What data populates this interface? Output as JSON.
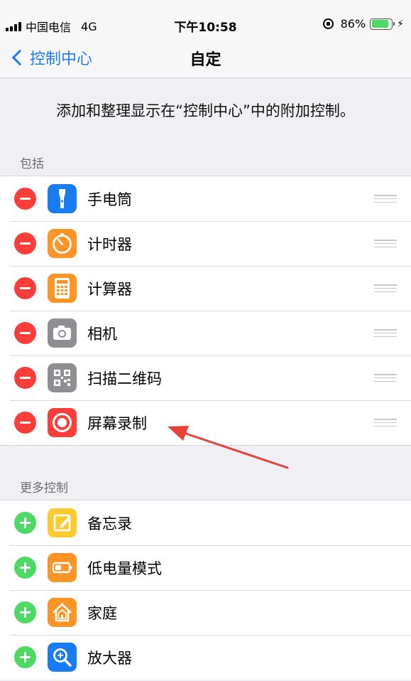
{
  "window": {
    "minimize": "—",
    "maximize": "☐",
    "close": "✕"
  },
  "status_bar": {
    "carrier": "中国电信",
    "network": "4G",
    "time": "下午10:58",
    "battery": "86%",
    "battery_level": 0.86
  },
  "nav": {
    "back_label": "控制中心",
    "title": "自定"
  },
  "description": "添加和整理显示在“控制中心”中的附加控制。",
  "included": {
    "header": "包括",
    "items": [
      {
        "label": "手电筒",
        "icon": "flashlight-icon",
        "color": "#1a7cf5"
      },
      {
        "label": "计时器",
        "icon": "timer-icon",
        "color": "#fd9426"
      },
      {
        "label": "计算器",
        "icon": "calculator-icon",
        "color": "#fd9426"
      },
      {
        "label": "相机",
        "icon": "camera-icon",
        "color": "#8e8e93"
      },
      {
        "label": "扫描二维码",
        "icon": "qr-code-icon",
        "color": "#8e8e93"
      },
      {
        "label": "屏幕录制",
        "icon": "screen-record-icon",
        "color": "#fc3d39"
      }
    ]
  },
  "more": {
    "header": "更多控制",
    "items": [
      {
        "label": "备忘录",
        "icon": "notes-icon",
        "color": "#fecb2e"
      },
      {
        "label": "低电量模式",
        "icon": "low-power-icon",
        "color": "#fd9426"
      },
      {
        "label": "家庭",
        "icon": "home-icon",
        "color": "#fd9426"
      },
      {
        "label": "放大器",
        "icon": "magnifier-icon",
        "color": "#1a7cf5"
      }
    ]
  }
}
